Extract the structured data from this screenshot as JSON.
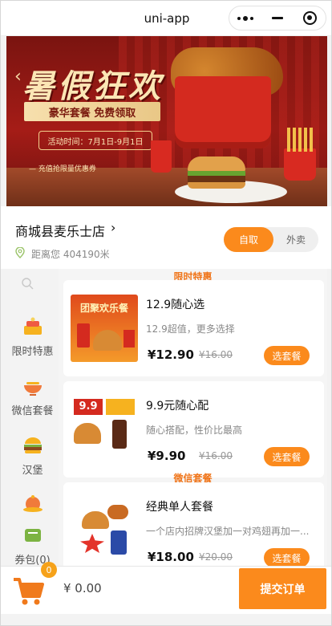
{
  "nav": {
    "title": "uni-app"
  },
  "banner": {
    "title": "暑假狂欢",
    "subtitle": "豪华套餐 免费领取",
    "date": "活动时间：7月1日-9月1日",
    "coupon": "— 充值抢限量优惠券"
  },
  "store": {
    "name": "商城县麦乐士店",
    "distance": "距离您 404190米",
    "modes": [
      "自取",
      "外卖"
    ],
    "active_mode": "自取"
  },
  "sidebar": {
    "items": [
      {
        "label": "限时特惠",
        "icon": "cake-icon"
      },
      {
        "label": "微信套餐",
        "icon": "bowl-icon"
      },
      {
        "label": "汉堡",
        "icon": "burger-icon"
      },
      {
        "label": "",
        "icon": "dish-icon"
      },
      {
        "label": "券包(0)",
        "icon": "coupon-icon"
      }
    ]
  },
  "sections": [
    {
      "title": "限时特惠",
      "products": [
        {
          "name": "12.9随心选",
          "desc": "12.9超值，更多选择",
          "price": "¥12.90",
          "old_price": "¥16.00",
          "button": "选套餐",
          "thumb_text": "团聚欢乐餐"
        },
        {
          "name": "9.9元随心配",
          "desc": "随心搭配，性价比最高",
          "price": "¥9.90",
          "old_price": "¥16.00",
          "button": "选套餐",
          "thumb_text": "9.9"
        }
      ]
    },
    {
      "title": "微信套餐",
      "products": [
        {
          "name": "经典单人套餐",
          "desc": "一个店内招牌汉堡加一对鸡翅再加一...",
          "price": "¥18.00",
          "old_price": "¥20.00",
          "button": "选套餐",
          "thumb_text": ""
        }
      ]
    }
  ],
  "cart": {
    "count": "0",
    "total": "¥ 0.00",
    "submit": "提交订单"
  },
  "colors": {
    "accent": "#fb8a1c",
    "section_title": "#f0751a"
  }
}
